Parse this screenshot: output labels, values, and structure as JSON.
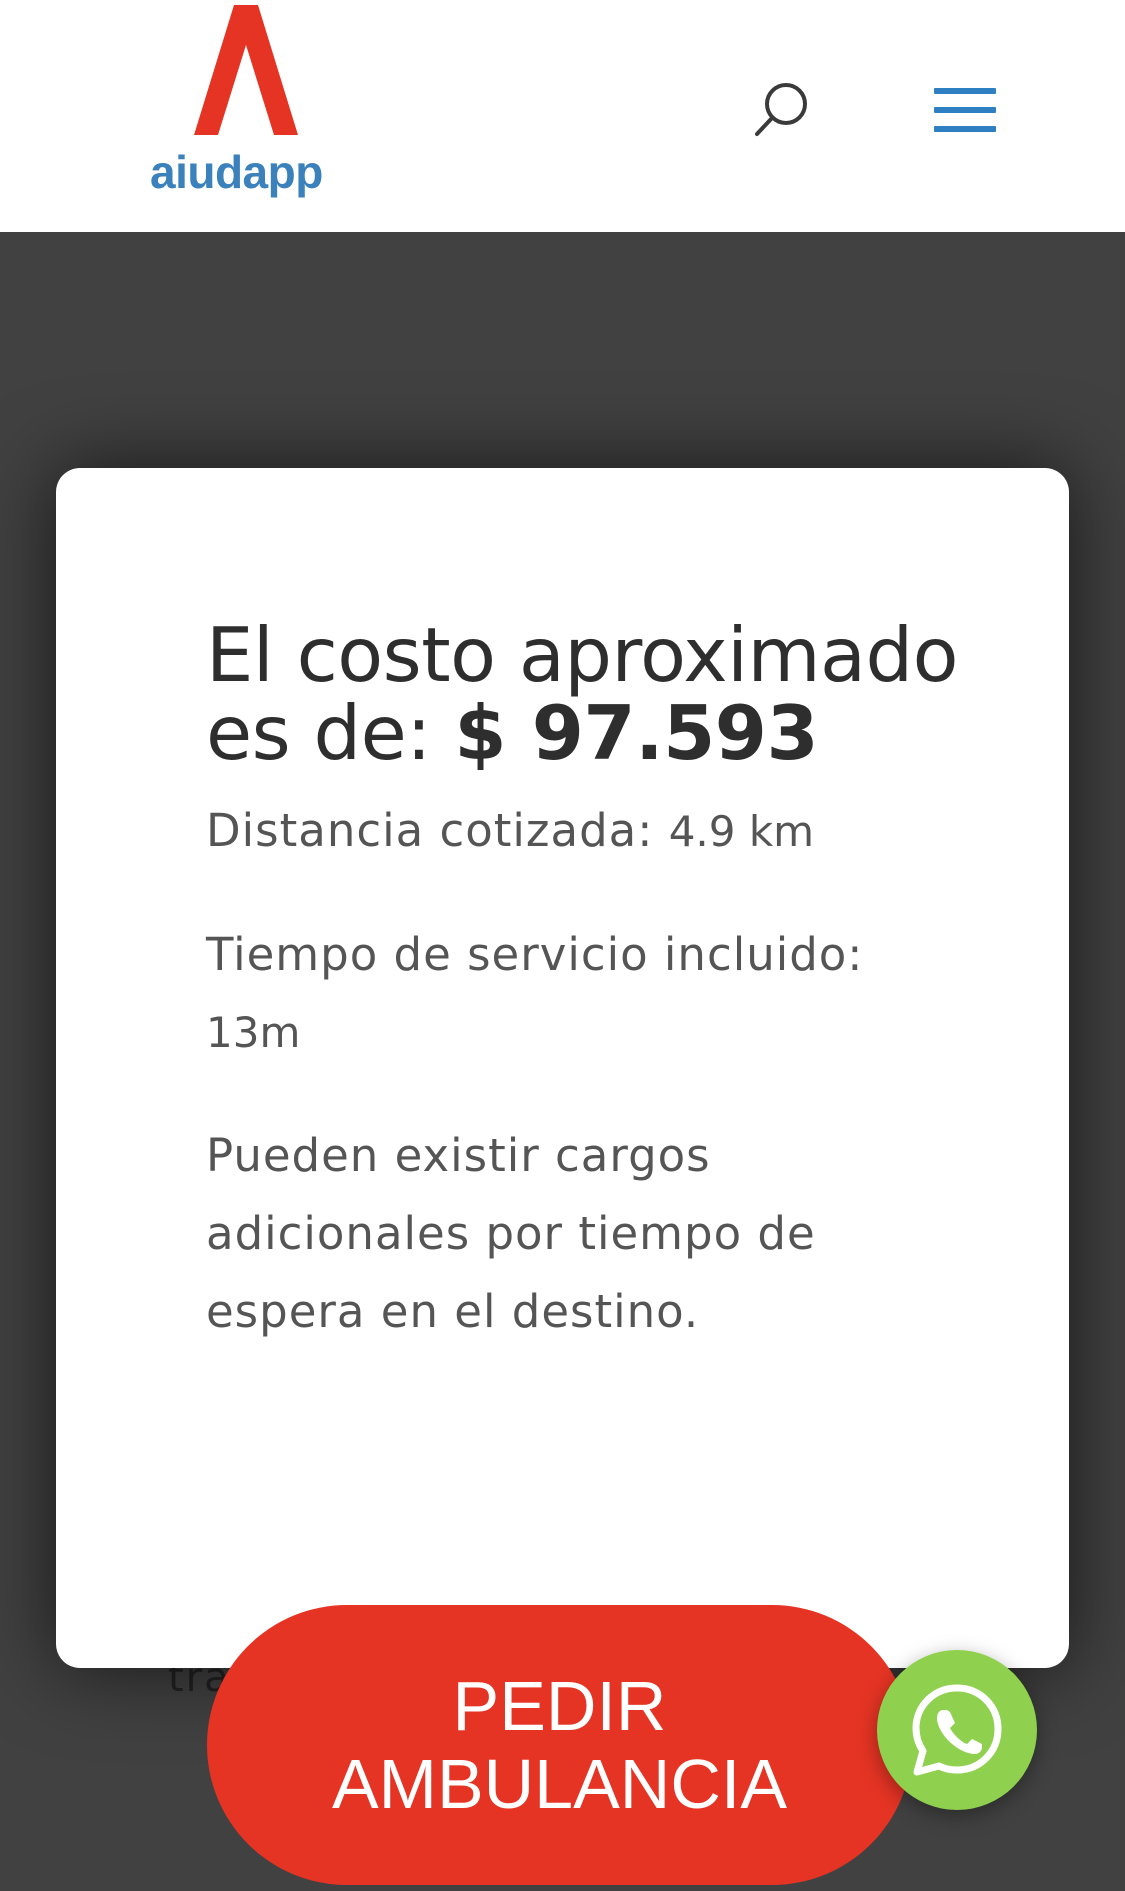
{
  "header": {
    "logo_text": "aiudapp",
    "search_icon": "search-icon",
    "menu_icon": "hamburger-menu-icon"
  },
  "background": {
    "partial_text": "tras"
  },
  "modal": {
    "title_prefix": "El costo aproximado es de: ",
    "price": "$ 97.593",
    "distance_label": "Distancia cotizada: ",
    "distance_value": "4.9 km",
    "time_label": "Tiempo de servicio incluido: ",
    "time_value": "13m",
    "note": "Pueden existir cargos adicionales por tiempo de espera en el destino."
  },
  "cta": {
    "line1": "PEDIR",
    "line2": "AMBULANCIA"
  },
  "whatsapp": {
    "icon": "whatsapp-icon"
  },
  "colors": {
    "brand_red": "#e53424",
    "brand_blue": "#3b82bd",
    "overlay": "#414141",
    "whatsapp_green": "#8fd14f"
  }
}
